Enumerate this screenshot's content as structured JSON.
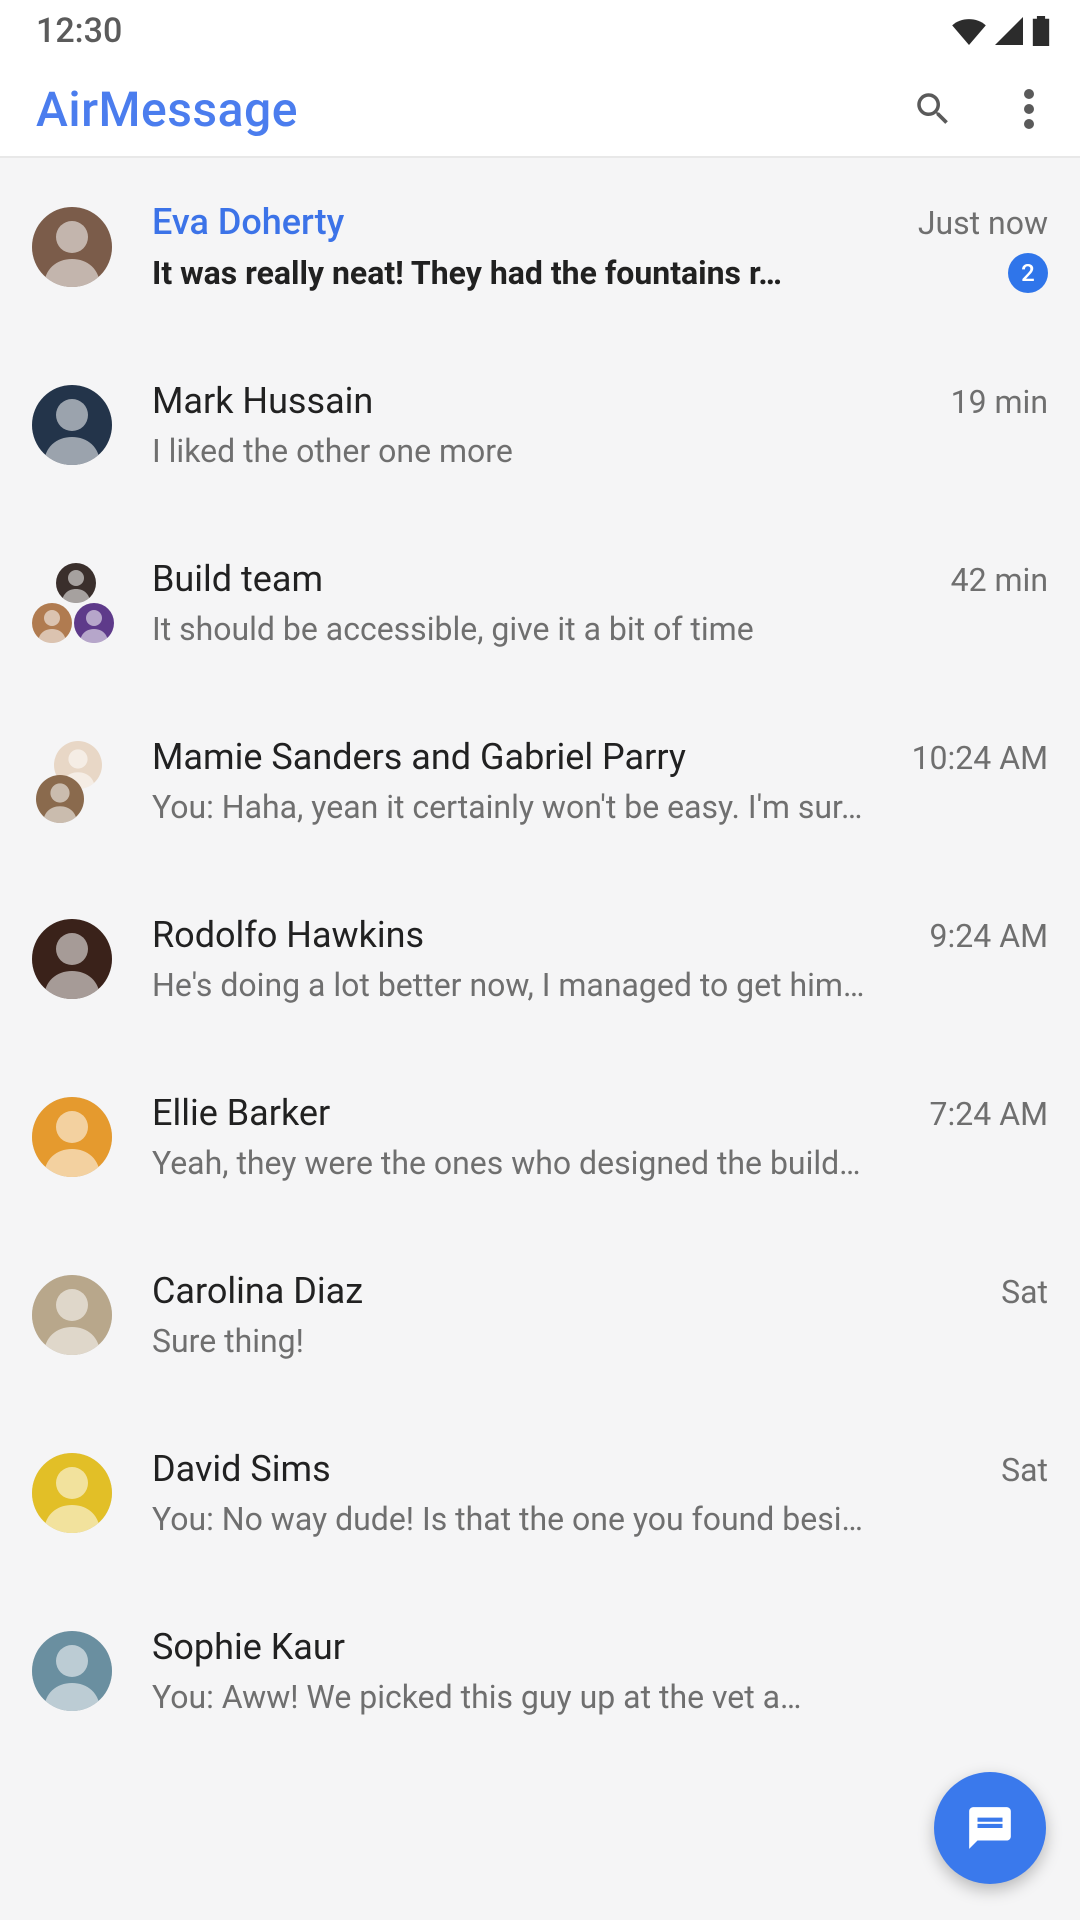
{
  "status_bar": {
    "time": "12:30"
  },
  "header": {
    "title": "AirMessage"
  },
  "conversations": [
    {
      "name": "Eva Doherty",
      "timestamp": "Just now",
      "preview": "It was really neat! They had the fountains r…",
      "unread": true,
      "unread_count": "2",
      "avatar_type": "single",
      "avatar_colors": [
        "#7b5c4a"
      ]
    },
    {
      "name": "Mark Hussain",
      "timestamp": "19 min",
      "preview": "I liked the other one more",
      "unread": false,
      "avatar_type": "single",
      "avatar_colors": [
        "#23344a"
      ]
    },
    {
      "name": "Build team",
      "timestamp": "42 min",
      "preview": "It should be accessible, give it a bit of time",
      "unread": false,
      "avatar_type": "group3",
      "avatar_colors": [
        "#3a2f2c",
        "#b07b50",
        "#5e3a8a"
      ]
    },
    {
      "name": "Mamie Sanders and Gabriel Parry",
      "timestamp": "10:24 AM",
      "preview": "You: Haha, yean it certainly won't be easy. I'm sur…",
      "unread": false,
      "avatar_type": "group2",
      "avatar_colors": [
        "#e8d7c6",
        "#8a6a4d"
      ]
    },
    {
      "name": "Rodolfo Hawkins",
      "timestamp": "9:24 AM",
      "preview": "He's doing a lot better now, I managed to get him…",
      "unread": false,
      "avatar_type": "single",
      "avatar_colors": [
        "#3a221a"
      ]
    },
    {
      "name": "Ellie Barker",
      "timestamp": "7:24 AM",
      "preview": "Yeah, they were the ones who designed the build…",
      "unread": false,
      "avatar_type": "single",
      "avatar_colors": [
        "#e59a2e"
      ]
    },
    {
      "name": "Carolina Diaz",
      "timestamp": "Sat",
      "preview": "Sure thing!",
      "unread": false,
      "avatar_type": "single",
      "avatar_colors": [
        "#b8a78b"
      ]
    },
    {
      "name": "David Sims",
      "timestamp": "Sat",
      "preview": "You: No way dude! Is that the one you found besi…",
      "unread": false,
      "avatar_type": "single",
      "avatar_colors": [
        "#e2bf27"
      ]
    },
    {
      "name": "Sophie Kaur",
      "timestamp": "",
      "preview": "You: Aww! We picked this guy up at the vet a…",
      "unread": false,
      "avatar_type": "single",
      "avatar_colors": [
        "#6a8fa0"
      ]
    }
  ]
}
